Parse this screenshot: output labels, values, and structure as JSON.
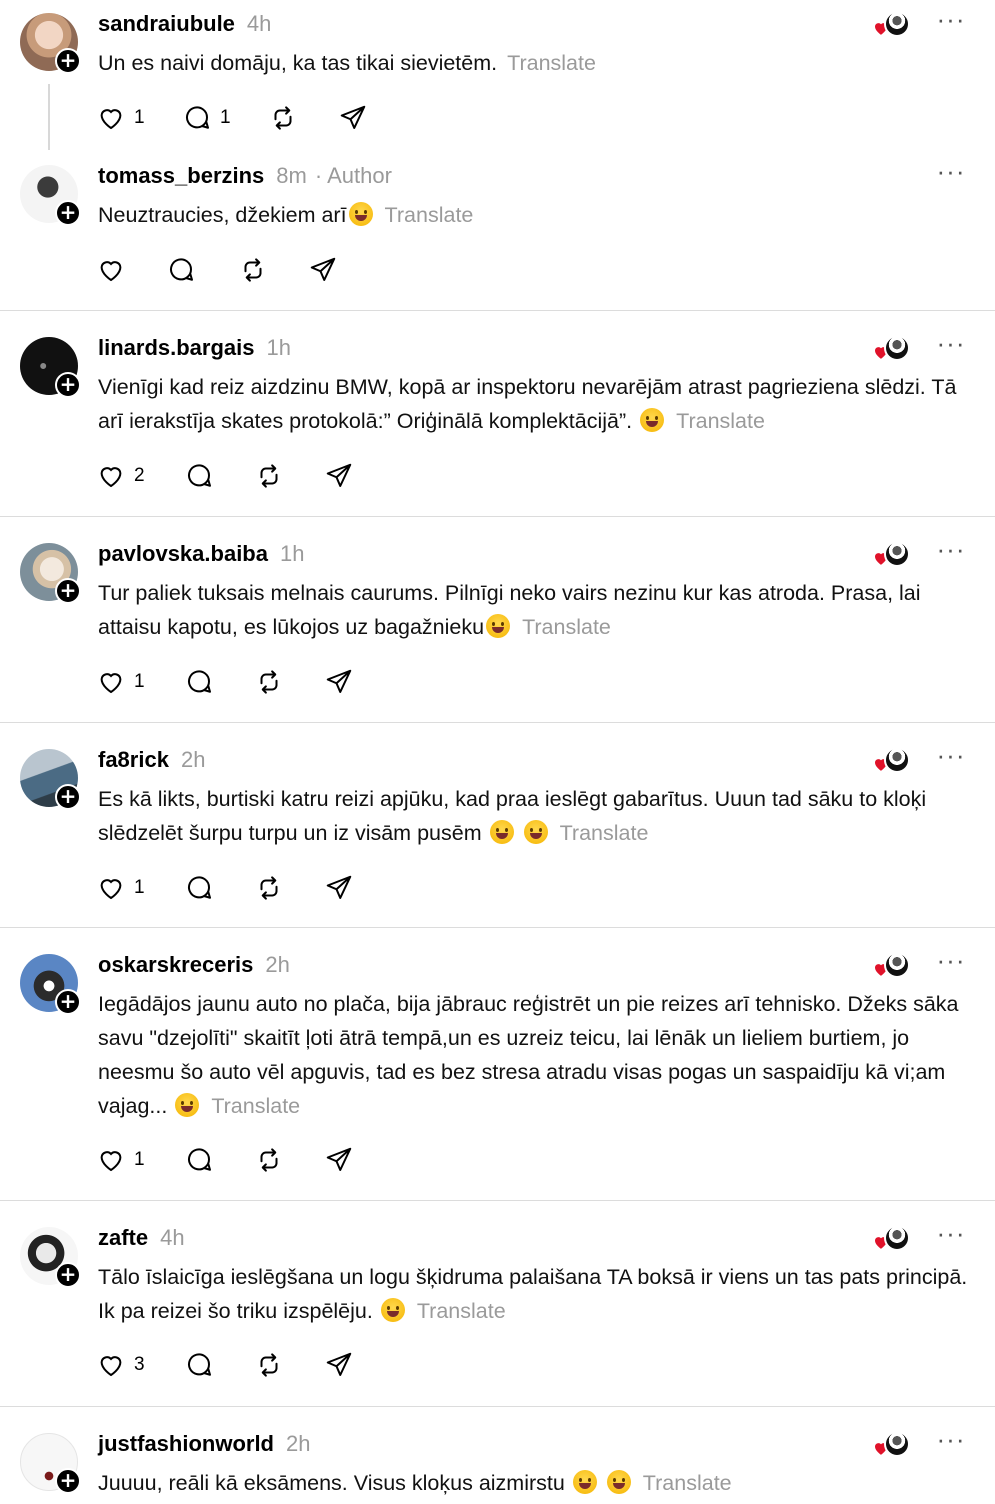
{
  "translate_label": "Translate",
  "author_label": "· Author",
  "posts": [
    {
      "username": "sandraiubule",
      "time": "4h",
      "text": "Un es naivi domāju, ka tas tikai sievietēm.",
      "likes": "1",
      "replies": "1"
    },
    {
      "username": "tomass_berzins",
      "time": "8m",
      "text": "Neuztraucies, džekiem arī",
      "likes": "",
      "replies": ""
    },
    {
      "username": "linards.bargais",
      "time": "1h",
      "text": "Vienīgi kad reiz aizdzinu BMW, kopā ar inspektoru nevarējām atrast pagrieziena slēdzi. Tā arī ierakstīja skates protokolā:” Oriģinālā komplektācijā”.",
      "likes": "2",
      "replies": ""
    },
    {
      "username": "pavlovska.baiba",
      "time": "1h",
      "text": "Tur paliek tuksais melnais caurums. Pilnīgi neko vairs nezinu kur kas atroda. Prasa, lai attaisu kapotu, es lūkojos uz bagažnieku",
      "likes": "1",
      "replies": ""
    },
    {
      "username": "fa8rick",
      "time": "2h",
      "text": "Es kā likts, burtiski katru reizi apjūku, kad praa ieslēgt gabarītus. Uuun tad sāku to kloķi slēdzelēt šurpu turpu un iz visām pusēm",
      "likes": "1",
      "replies": ""
    },
    {
      "username": "oskarskreceris",
      "time": "2h",
      "text": "Iegādājos jaunu auto no plača, bija jābrauc reģistrēt un pie reizes arī tehnisko. Džeks sāka savu \"dzejolīti\" skaitīt ļoti ātrā tempā,un es uzreiz teicu, lai lēnāk un lieliem burtiem, jo neesmu šo auto vēl apguvis, tad es bez stresa atradu visas pogas un saspaidīju kā vi;am vajag...",
      "likes": "1",
      "replies": ""
    },
    {
      "username": "zafte",
      "time": "4h",
      "text": "Tālo īslaicīga ieslēgšana un logu šķidruma palaišana TA boksā ir viens un tas pats principā. Ik pa reizei šo triku izspēlēju.",
      "likes": "3",
      "replies": ""
    },
    {
      "username": "justfashionworld",
      "time": "2h",
      "text": "Juuuu, reāli kā eksāmens. Visus kloķus aizmirstu",
      "likes": "",
      "replies": ""
    }
  ],
  "icons": {
    "like": "heart-icon",
    "reply": "comment-icon",
    "repost": "repost-icon",
    "share": "send-icon",
    "more": "more-icon"
  },
  "colors": {
    "accent_heart": "#e0122a",
    "muted_text": "#9a9a9a"
  }
}
